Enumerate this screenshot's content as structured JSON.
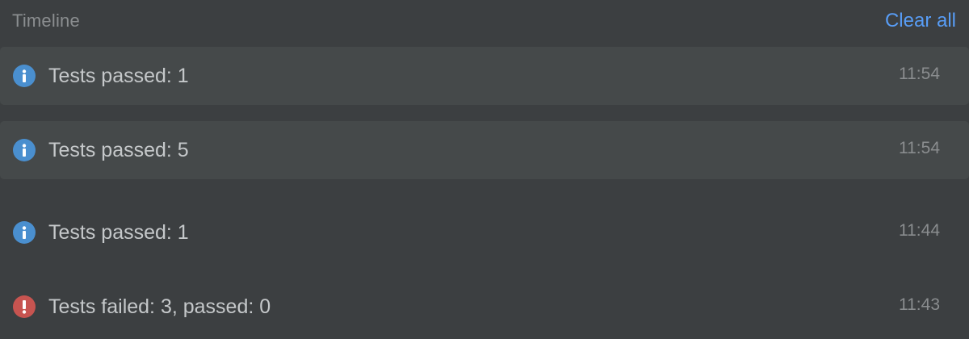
{
  "header": {
    "title": "Timeline",
    "clear_all_label": "Clear all"
  },
  "colors": {
    "background": "#3c3f41",
    "highlight_row": "#45494a",
    "info_icon": "#4a8fcf",
    "error_icon": "#c75450",
    "link": "#589df6"
  },
  "notifications": [
    {
      "icon": "info-icon",
      "type": "info",
      "text": "Tests passed: 1",
      "time": "11:54",
      "highlighted": true
    },
    {
      "icon": "info-icon",
      "type": "info",
      "text": "Tests passed: 5",
      "time": "11:54",
      "highlighted": true
    },
    {
      "icon": "info-icon",
      "type": "info",
      "text": "Tests passed: 1",
      "time": "11:44",
      "highlighted": false
    },
    {
      "icon": "error-icon",
      "type": "error",
      "text": "Tests failed: 3, passed: 0",
      "time": "11:43",
      "highlighted": false
    }
  ]
}
